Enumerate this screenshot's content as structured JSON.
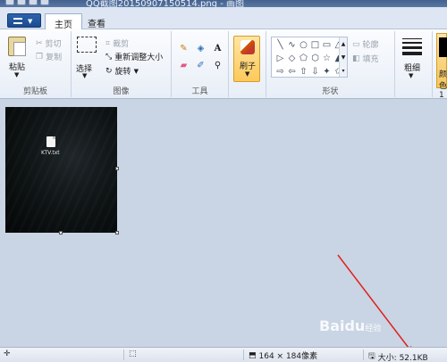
{
  "window": {
    "title": "QQ截图20150907150514.png - 画图"
  },
  "tabs": {
    "home": "主页",
    "view": "查看"
  },
  "clipboard": {
    "paste": "粘贴",
    "cut": "剪切",
    "copy": "复制",
    "group": "剪贴板"
  },
  "image": {
    "select": "选择",
    "crop": "裁剪",
    "resize": "重新调整大小",
    "rotate": "旋转",
    "group": "图像"
  },
  "tools": {
    "group": "工具",
    "text_icon": "A"
  },
  "brushes": {
    "label": "刷子"
  },
  "shapes": {
    "group": "形状",
    "outline": "轮廓",
    "fill": "填充",
    "glyphs": [
      "╲",
      "∿",
      "○",
      "□",
      "▭",
      "△",
      "▷",
      "◇",
      "⬠",
      "⬡",
      "☆",
      "▲",
      "⇨",
      "⇦",
      "⇧",
      "⇩",
      "✦",
      "✩"
    ]
  },
  "size": {
    "label": "粗细"
  },
  "colors": {
    "color1": "颜色1",
    "accent": "#fdc95c"
  },
  "canvas": {
    "file_name": "KTV.txt"
  },
  "status": {
    "dimensions": "164 × 184像素",
    "size": "大小: 52.1KB"
  },
  "watermark": {
    "brand": "Baidu",
    "sub": "经验"
  }
}
